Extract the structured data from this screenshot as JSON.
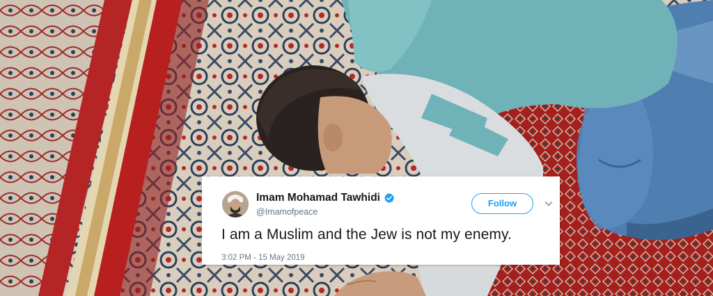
{
  "tweet": {
    "author_name": "Imam Mohamad Tawhidi",
    "author_handle": "@Imamofpeace",
    "follow_label": "Follow",
    "text": "I am a Muslim and the Jew is not my enemy.",
    "timestamp": "3:02 PM - 15 May 2019",
    "verified_icon": "verified-badge-icon",
    "menu_icon": "chevron-down-icon"
  },
  "colors": {
    "twitter_blue": "#1da1f2",
    "text_primary": "#14171a",
    "text_secondary": "#657786",
    "carpet_red": "#a82222",
    "sweater_teal": "#6fb3b8",
    "jeans_blue": "#4f7fb0"
  }
}
